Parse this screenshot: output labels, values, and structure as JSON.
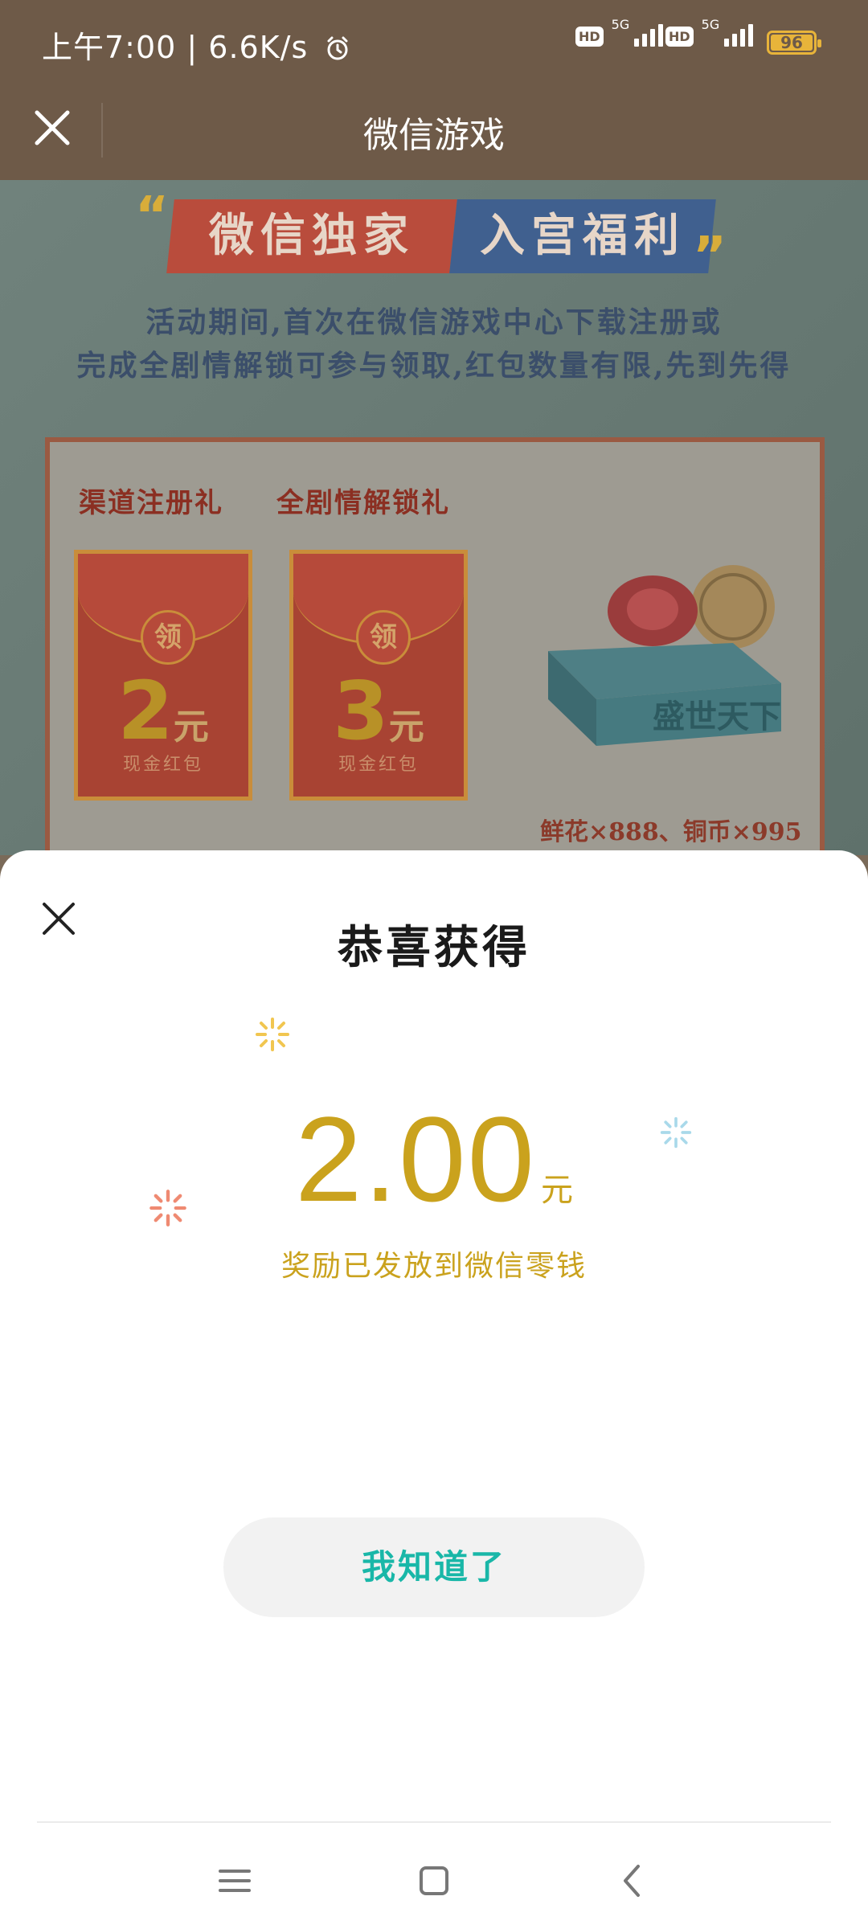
{
  "status_bar": {
    "time": "上午7:00 | 6.6K/s",
    "sim1_label": "HD",
    "sim1_net": "5G",
    "sim2_label": "HD",
    "sim2_net": "5G",
    "battery": "96"
  },
  "title_bar": {
    "title": "微信游戏"
  },
  "promo": {
    "banner_left": "微信独家",
    "banner_right": "入宫福利",
    "description_line1": "活动期间,首次在微信游戏中心下载注册或",
    "description_line2": "完成全剧情解锁可参与领取,红包数量有限,先到先得",
    "gift1_title": "渠道注册礼",
    "gift2_title": "全剧情解锁礼",
    "envelope_seal": "领",
    "envelope1_amount": "2",
    "envelope2_amount": "3",
    "envelope_unit": "元",
    "envelope_caption": "现金红包",
    "box_brand": "盛世天下",
    "box_rewards": "鲜花×888、铜币×995"
  },
  "sheet": {
    "title": "恭喜获得",
    "amount": "2.00",
    "unit": "元",
    "note": "奖励已发放到微信零钱",
    "button": "我知道了"
  },
  "colors": {
    "accent_gold": "#caa21d",
    "button_text": "#19b7a8",
    "header_bg": "#6e5a48"
  }
}
